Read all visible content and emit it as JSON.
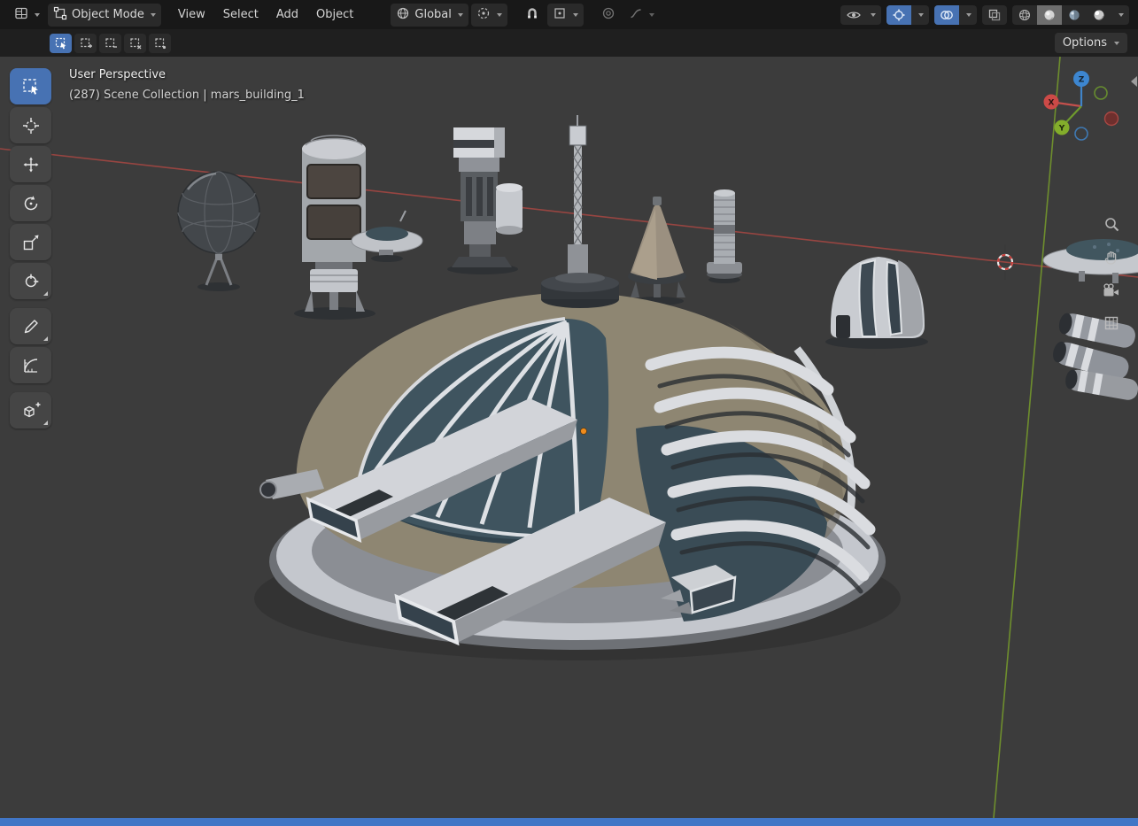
{
  "topbar": {
    "mode_label": "Object Mode",
    "menus": [
      "View",
      "Select",
      "Add",
      "Object"
    ],
    "orientation_label": "Global"
  },
  "tool_settings": {
    "options_label": "Options"
  },
  "viewport": {
    "view_label": "User Perspective",
    "breadcrumb": "(287) Scene Collection | mars_building_1",
    "gizmo": {
      "x_label": "X",
      "y_label": "Y",
      "z_label": "Z"
    }
  },
  "icons": {
    "editor-type-icon": "3d viewport editor selector",
    "object-mode-icon": "object mode square",
    "chevron-down-icon": "dropdown chevron",
    "transform-orientation-icon": "globe",
    "pivot-point-icon": "dashed circle with center dot",
    "magnet-icon": "snap toggle magnet",
    "snap-target-icon": "snap-to settings",
    "proportional-editing-icon": "concentric circles",
    "falloff-curve-icon": "smooth falloff curve",
    "eye-icon": "object type visibility",
    "show-gizmos-icon": "viewport gizmos toggle (on)",
    "show-overlays-icon": "viewport overlays toggle (on)",
    "xray-icon": "toggle x-ray",
    "shading-wireframe-icon": "wireframe shading",
    "shading-solid-icon": "solid shading (active)",
    "shading-material-icon": "material preview shading",
    "shading-rendered-icon": "rendered shading",
    "select-mode-icons": "tweak / box-select mode variants",
    "tool-select-box-icon": "select box tool (active)",
    "tool-cursor-icon": "3d cursor tool",
    "tool-move-icon": "move tool",
    "tool-rotate-icon": "rotate tool",
    "tool-scale-icon": "scale tool",
    "tool-transform-icon": "transform tool",
    "tool-annotate-icon": "annotate tool",
    "tool-measure-icon": "measure tool",
    "tool-add-cube-icon": "add cube tool",
    "zoom-icon": "viewport zoom",
    "pan-hand-icon": "viewport pan hand",
    "camera-icon": "toggle camera view",
    "ortho-grid-icon": "toggle orthographic view",
    "axis-gizmo": "navigation axis gizmo",
    "cursor-3d-icon": "3d cursor crosshair"
  },
  "colors": {
    "accent_blue": "#4772b3",
    "topbar_bg": "#181818",
    "tool_header_bg": "#1f1f1f",
    "viewport_bg": "#3c3c3c",
    "axis_x_red": "#cc4a47",
    "axis_y_green": "#83ad2b",
    "axis_z_blue": "#3d86d0",
    "status_bar_blue": "#4176c6",
    "dome_khaki": "#8e8672",
    "glass_teal": "#3f545f"
  }
}
